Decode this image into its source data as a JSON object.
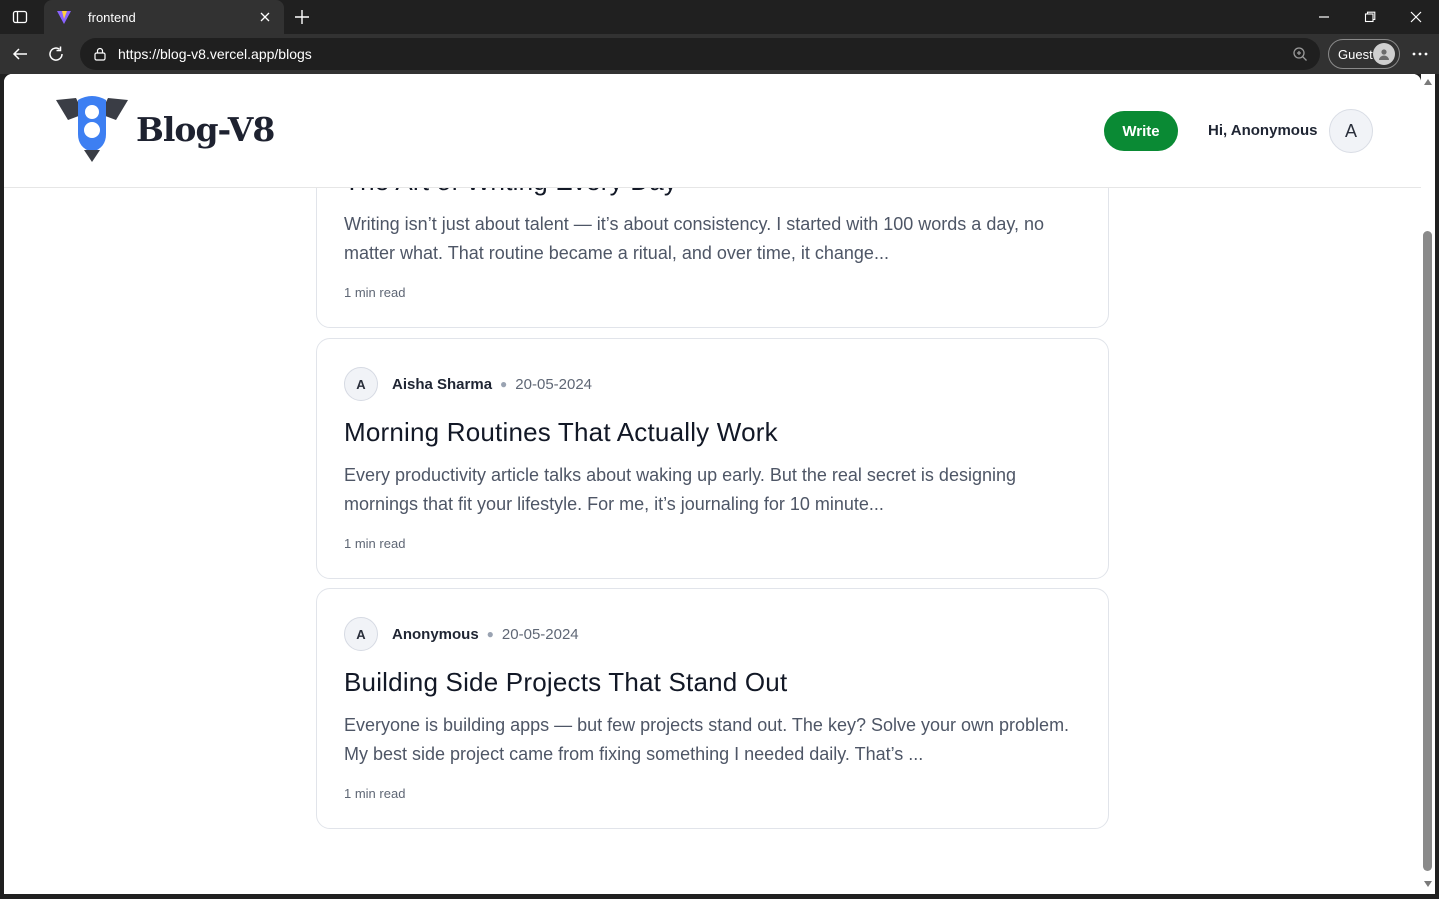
{
  "browser": {
    "tab_title": "frontend",
    "url": "https://blog-v8.vercel.app/blogs",
    "profile_label": "Guest"
  },
  "site": {
    "brand": "Blog-V8",
    "write_label": "Write",
    "greeting": "Hi, Anonymous",
    "user_initial": "A"
  },
  "posts": [
    {
      "title": "The Art of Writing Every Day",
      "excerpt": "Writing isn’t just about talent — it’s about consistency. I started with 100 words a day, no matter what. That routine became a ritual, and over time, it change...",
      "read_time": "1 min read"
    },
    {
      "initial": "A",
      "author": "Aisha Sharma",
      "date": "20-05-2024",
      "title": "Morning Routines That Actually Work",
      "excerpt": "Every productivity article talks about waking up early. But the real secret is designing mornings that fit your lifestyle. For me, it’s journaling for 10 minute...",
      "read_time": "1 min read"
    },
    {
      "initial": "A",
      "author": "Anonymous",
      "date": "20-05-2024",
      "title": "Building Side Projects That Stand Out",
      "excerpt": "Everyone is building apps — but few projects stand out. The key? Solve your own problem. My best side project came from fixing something I needed daily. That’s ...",
      "read_time": "1 min read"
    }
  ],
  "colors": {
    "write_button": "#0a8a34",
    "logo_blue": "#3d7ff2",
    "logo_dark": "#3a3d45"
  }
}
